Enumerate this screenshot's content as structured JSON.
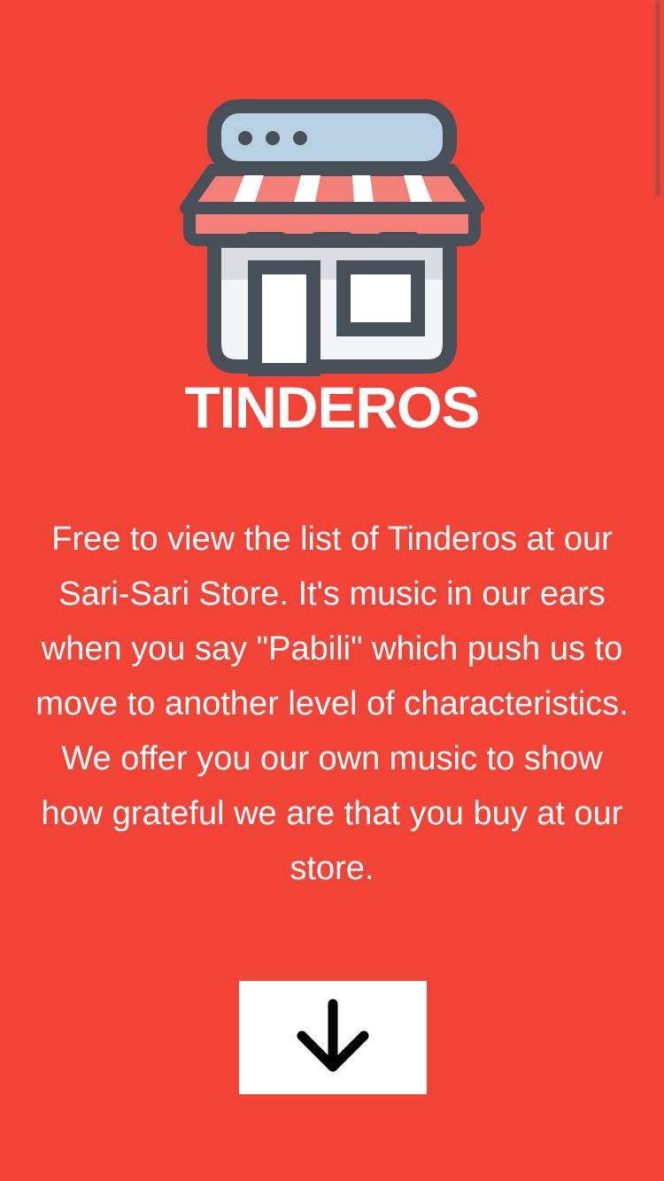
{
  "app": {
    "logo_icon": "storefront-icon",
    "title": "TINDEROS"
  },
  "main": {
    "description": "Free to view the list of Tinderos at our Sari-Sari Store. It's music in our ears when you say \"Pabili\" which push us to move to another level of characteristics. We offer you our own music to show how grateful we are that you buy at our store.",
    "down_button_icon": "arrow-down-icon"
  },
  "colors": {
    "background": "#f24337",
    "button": "#ffffff",
    "icon_outline": "#474f59",
    "awning_stripe": "#f47f76",
    "roof_panel": "#b7d1e2"
  }
}
